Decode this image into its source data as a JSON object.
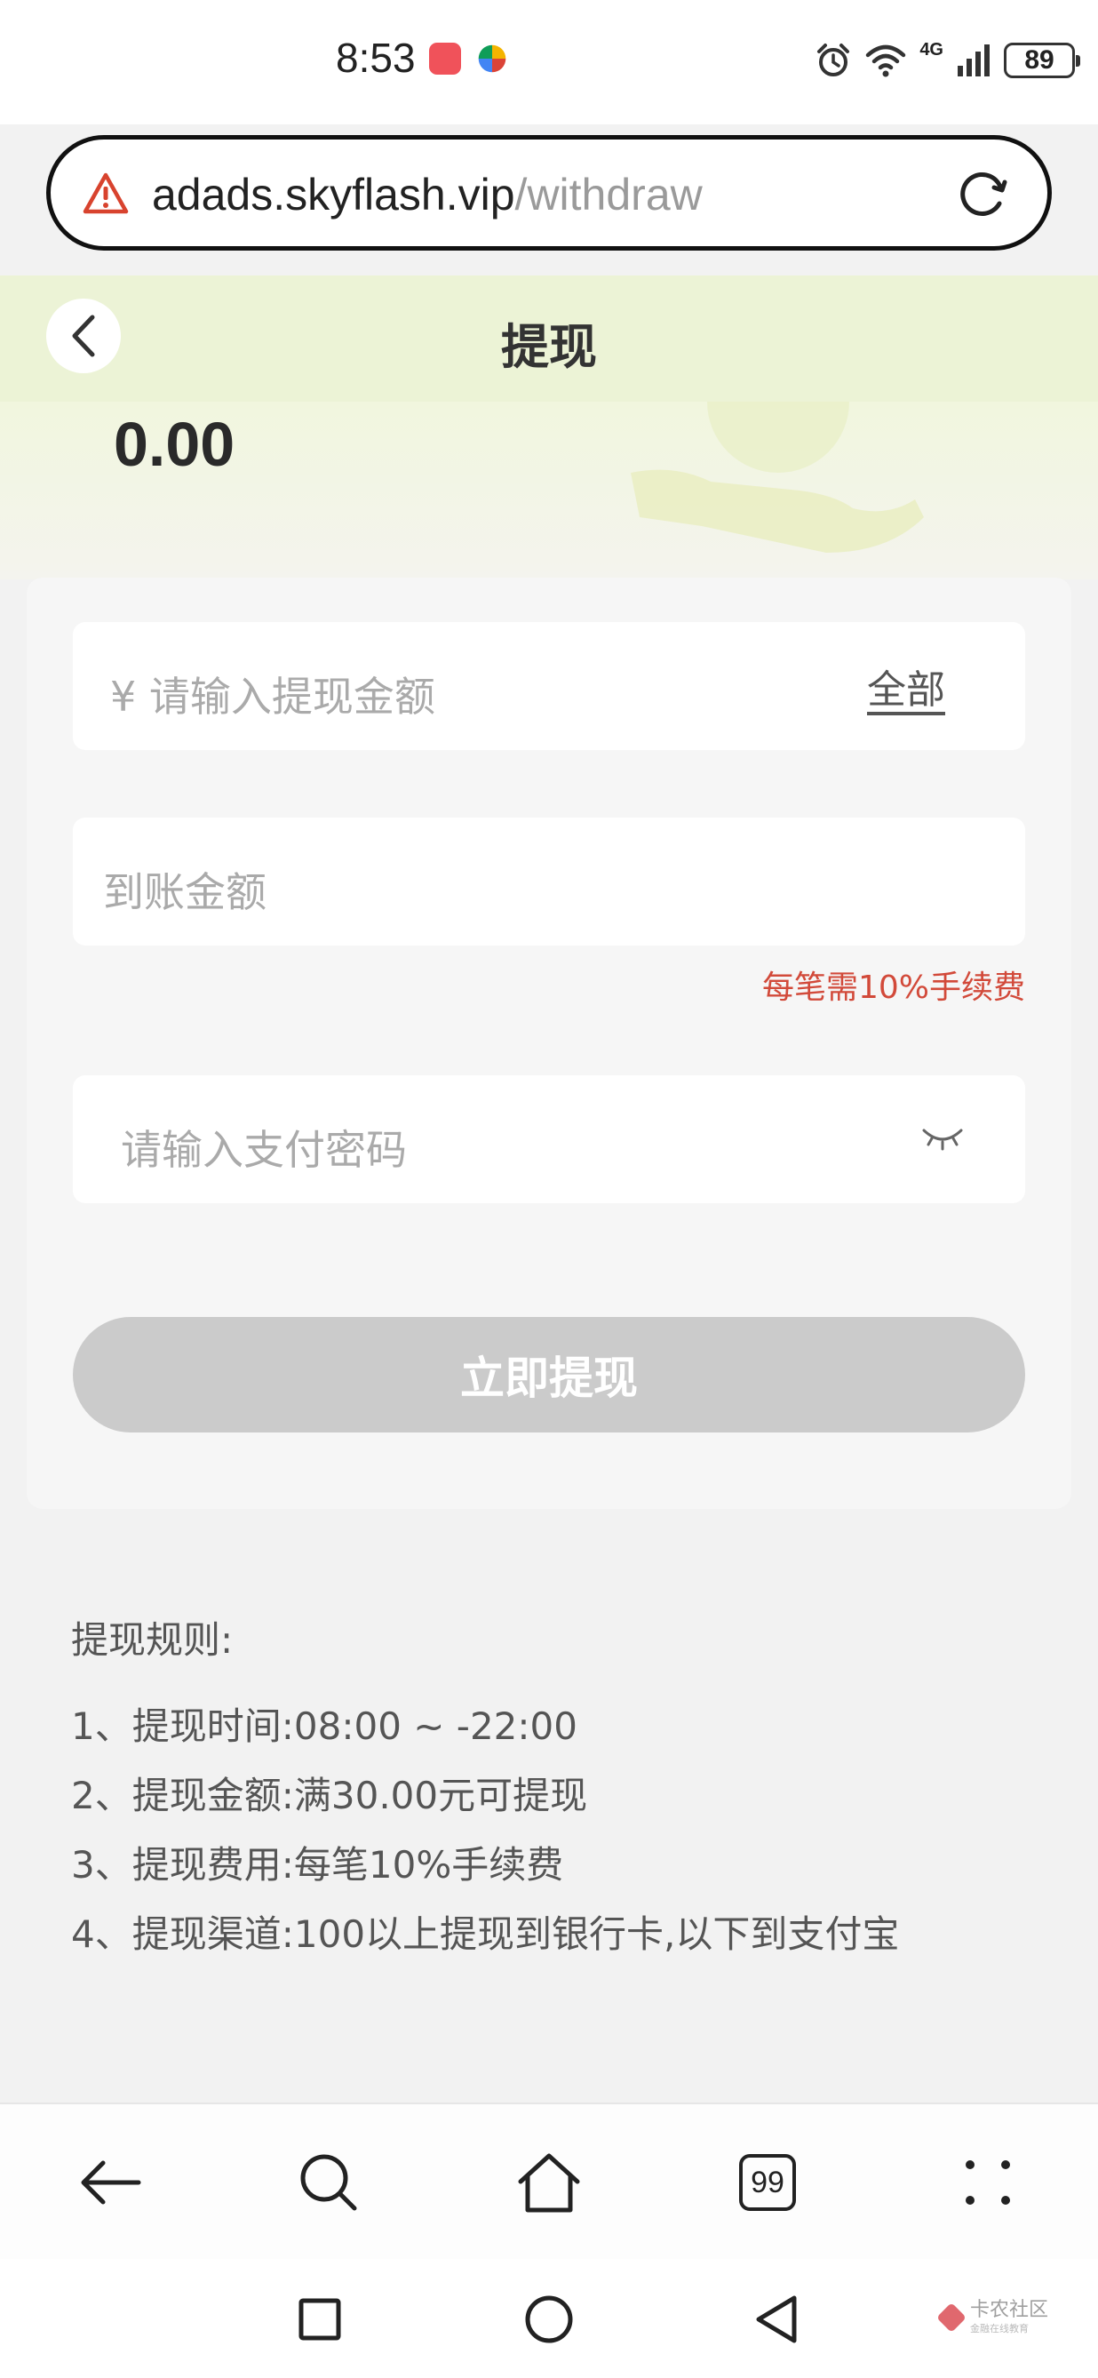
{
  "status_bar": {
    "time": "8:53",
    "network_label": "4G",
    "battery": "89"
  },
  "url_bar": {
    "host": "adads.skyflash.vip",
    "path": "/withdraw"
  },
  "header": {
    "title": "提现"
  },
  "balance": {
    "amount": "0.00"
  },
  "form": {
    "amount_placeholder": "¥ 请输入提现金额",
    "all_label": "全部",
    "receive_placeholder": "到账金额",
    "fee_note": "每笔需10%手续费",
    "password_placeholder": "请输入支付密码",
    "submit_label": "立即提现"
  },
  "rules": {
    "title": "提现规则:",
    "items": [
      "1、提现时间:08:00 ~ -22:00",
      "2、提现金额:满30.00元可提现",
      "3、提现费用:每笔10%手续费",
      "4、提现渠道:100以上提现到银行卡,以下到支付宝"
    ]
  },
  "browser_bar": {
    "tabs_count": "99"
  },
  "watermark": {
    "text": "卡农社区",
    "sub": "金融在线教育"
  },
  "colors": {
    "header_bg": "#ecf3d6",
    "fee_note": "#d24a3a",
    "submit_disabled": "#cbcbcb"
  }
}
